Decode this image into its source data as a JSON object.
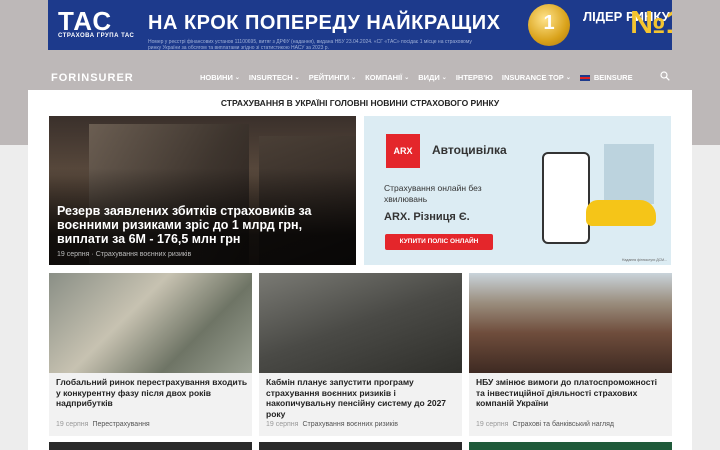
{
  "banner": {
    "logo": "ТАС",
    "logo_sub": "СТРАХОВА ГРУПА ТАС",
    "slogan": "НА КРОК ПОПЕРЕДУ НАЙКРАЩИХ",
    "fine_print": "Номер у реєстрі фінансових установ 11100695, витяг з ДРФУ (надання), видана НБУ 23.04.2024. «СГ «ТАС» посідає 1 місце на страховому ринку України за обсягом та виплатами згідно зі статистикою НАСУ за 2023 р.",
    "medal": "1",
    "leader": "ЛІДЕР РИНКУ",
    "no1": "№1"
  },
  "nav": {
    "brand": "FORINSURER",
    "items": [
      {
        "label": "НОВИНИ",
        "dropdown": true
      },
      {
        "label": "INSURTECH",
        "dropdown": true
      },
      {
        "label": "РЕЙТИНГИ",
        "dropdown": true
      },
      {
        "label": "КОМПАНІЇ",
        "dropdown": true
      },
      {
        "label": "ВИДИ",
        "dropdown": true
      },
      {
        "label": "ІНТЕРВ'Ю",
        "dropdown": false
      },
      {
        "label": "INSURANCE TOP",
        "dropdown": true
      },
      {
        "label": "BEINSURE",
        "dropdown": false,
        "flag": true
      }
    ]
  },
  "section_title": "СТРАХУВАННЯ В УКРАЇНІ  ГОЛОВНІ НОВИНИ СТРАХОВОГО РИНКУ",
  "hero": {
    "title": "Резерв заявлених збитків страховиків за воєнними ризиками зріс до 1 млрд грн, виплати за 6М - 176,5 млн грн",
    "date": "19 серпня",
    "category": "Страхування воєнних ризиків"
  },
  "ad": {
    "logo": "ARX",
    "title": "Автоцивілка",
    "text": "Страхування онлайн без хвилювань",
    "slogan": "ARX. Різниця Є.",
    "button": "КУПИТИ ПОЛІС ОНЛАЙН",
    "fine": "Надання фінпослуги ДСМ..."
  },
  "cards": [
    {
      "title": "Глобальний ринок перестрахування входить у конкурентну фазу після двох років надприбутків",
      "date": "19 серпня",
      "category": "Перестрахування"
    },
    {
      "title": "Кабмін планує запустити програму страхування воєнних ризиків і накопичувальну пенсійну систему до 2027 року",
      "date": "19 серпня",
      "category": "Страхування воєнних ризиків"
    },
    {
      "title": "НБУ змінює вимоги до платоспроможності та інвестиційної діяльності страхових компаній України",
      "date": "19 серпня",
      "category": "Страхові та банківський нагляд"
    }
  ]
}
